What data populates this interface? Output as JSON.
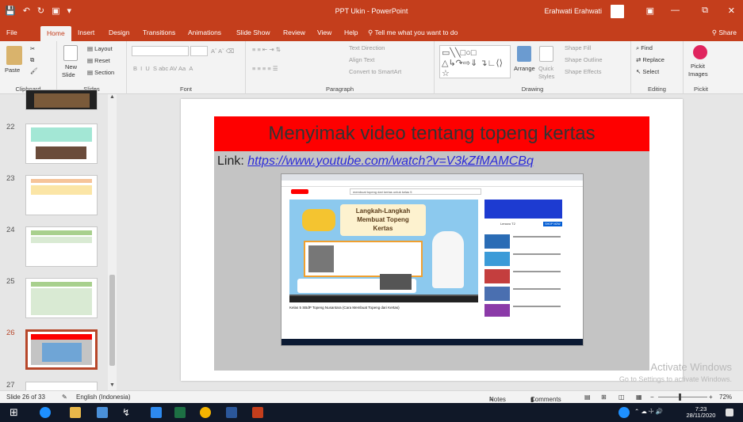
{
  "window": {
    "title": "PPT Ukin  -  PowerPoint",
    "user": "Erahwati Erahwati"
  },
  "tabs": [
    "File",
    "Home",
    "Insert",
    "Design",
    "Transitions",
    "Animations",
    "Slide Show",
    "Review",
    "View",
    "Help"
  ],
  "tell_me": "Tell me what you want to do",
  "share": "Share",
  "ribbon": {
    "clipboard": {
      "label": "Clipboard",
      "paste": "Paste"
    },
    "slides": {
      "label": "Slides",
      "new_slide": "New",
      "new_slide2": "Slide",
      "layout": "Layout",
      "reset": "Reset",
      "section": "Section"
    },
    "font": {
      "label": "Font"
    },
    "paragraph": {
      "label": "Paragraph",
      "text_direction": "Text Direction",
      "align_text": "Align Text",
      "convert": "Convert to SmartArt"
    },
    "drawing": {
      "label": "Drawing",
      "arrange": "Arrange",
      "quick": "Quick",
      "styles": "Styles",
      "shape_fill": "Shape Fill",
      "shape_outline": "Shape Outline",
      "shape_effects": "Shape Effects"
    },
    "editing": {
      "label": "Editing",
      "find": "Find",
      "replace": "Replace",
      "select": "Select"
    },
    "pickit": {
      "label": "Pickit",
      "pickit": "Pickit",
      "images": "Images"
    }
  },
  "thumbnails": [
    {
      "num": "22"
    },
    {
      "num": "23"
    },
    {
      "num": "24"
    },
    {
      "num": "25"
    },
    {
      "num": "26"
    },
    {
      "num": "27"
    }
  ],
  "slide": {
    "title": "Menyimak video tentang topeng kertas",
    "link_label": "Link: ",
    "link_url": "https://www.youtube.com/watch?v=V3kZfMAMCBq",
    "video": {
      "search": "membuat topeng dari kertas untuk kelas 5",
      "thumb_title_1": "Langkah-Langkah",
      "thumb_title_2": "Membuat Topeng",
      "thumb_title_3": "Kertas",
      "caption": "Kelas 5 SBdP Topeng Nusantara (Cara Membuat Topeng dari Kertas)",
      "shop": "SHOP NOW",
      "lenovo": "Lenovo T2"
    }
  },
  "watermark": {
    "line1": "Activate Windows",
    "line2": "Go to Settings to activate Windows."
  },
  "status": {
    "slide": "Slide 26 of 33",
    "language": "English (Indonesia)",
    "notes": "Notes",
    "comments": "Comments",
    "zoom": "72%"
  },
  "taskbar": {
    "time": "7:23",
    "date": "28/11/2020"
  },
  "colors": {
    "accent": "#c43e1c",
    "slide_title_bg": "#fe0000",
    "link": "#2b2bd9"
  }
}
